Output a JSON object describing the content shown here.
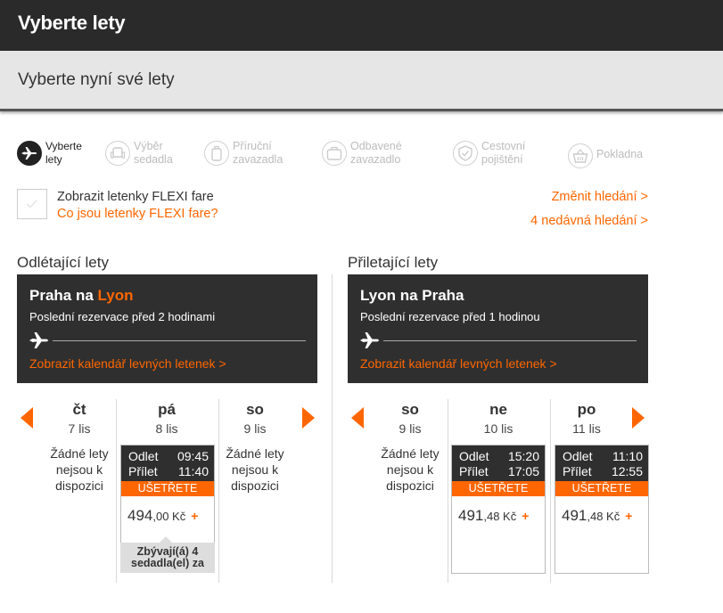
{
  "header": {
    "title": "Vyberte lety"
  },
  "subheader": {
    "title": "Vyberte nyní své lety"
  },
  "steps": [
    {
      "label": "Vyberte\nlety",
      "icon": "plane-icon",
      "active": true
    },
    {
      "label": "Výběr\nsedadla",
      "icon": "seat-icon",
      "active": false
    },
    {
      "label": "Příruční\nzavazadla",
      "icon": "cabin-bag-icon",
      "active": false
    },
    {
      "label": "Odbavené\nzavazadlo",
      "icon": "hold-bag-icon",
      "active": false
    },
    {
      "label": "Cestovní\npojištění",
      "icon": "shield-icon",
      "active": false
    },
    {
      "label": "Pokladna",
      "icon": "basket-icon",
      "active": false
    }
  ],
  "flexi": {
    "label": "Zobrazit letenky FLEXI fare",
    "link": "Co jsou letenky FLEXI fare?",
    "checked": false
  },
  "search_links": {
    "change": "Změnit hledání >",
    "recent": "4 nedávná hledání >"
  },
  "outbound": {
    "section_title": "Odlétající lety",
    "route_from": "Praha na",
    "route_to": "Lyon",
    "last_booking": "Poslední rezervace před 2 hodinami",
    "calendar_link": "Zobrazit kalendář levných letenek >",
    "days": [
      {
        "name": "čt",
        "date": "7 lis",
        "no_flights": "Žádné lety\nnejsou k\ndispozici"
      },
      {
        "name": "pá",
        "date": "8 lis"
      },
      {
        "name": "so",
        "date": "9 lis",
        "no_flights": "Žádné lety\nnejsou k\ndispozici"
      }
    ],
    "flight": {
      "depart_label": "Odlet",
      "depart_time": "09:45",
      "arrive_label": "Přílet",
      "arrive_time": "11:40",
      "save_label": "UŠETŘETE",
      "price_main": "494",
      "price_dec": ",00 Kč",
      "seats_left": "Zbývají(á) 4\nsedadla(el) za"
    }
  },
  "inbound": {
    "section_title": "Přiletající lety",
    "route": "Lyon na Praha",
    "last_booking": "Poslední rezervace před 1 hodinou",
    "calendar_link": "Zobrazit kalendář levných letenek >",
    "days": [
      {
        "name": "so",
        "date": "9 lis",
        "no_flights": "Žádné lety\nnejsou k\ndispozici"
      },
      {
        "name": "ne",
        "date": "10 lis"
      },
      {
        "name": "po",
        "date": "11 lis"
      }
    ],
    "flights": [
      {
        "depart_label": "Odlet",
        "depart_time": "15:20",
        "arrive_label": "Přílet",
        "arrive_time": "17:05",
        "save_label": "UŠETŘETE",
        "price_main": "491",
        "price_dec": ",48 Kč"
      },
      {
        "depart_label": "Odlet",
        "depart_time": "11:10",
        "arrive_label": "Přílet",
        "arrive_time": "12:55",
        "save_label": "UŠETŘETE",
        "price_main": "491",
        "price_dec": ",48 Kč"
      }
    ]
  },
  "colors": {
    "accent": "#ff6600",
    "dark": "#2f2f2f",
    "header": "#2a2a2a"
  }
}
